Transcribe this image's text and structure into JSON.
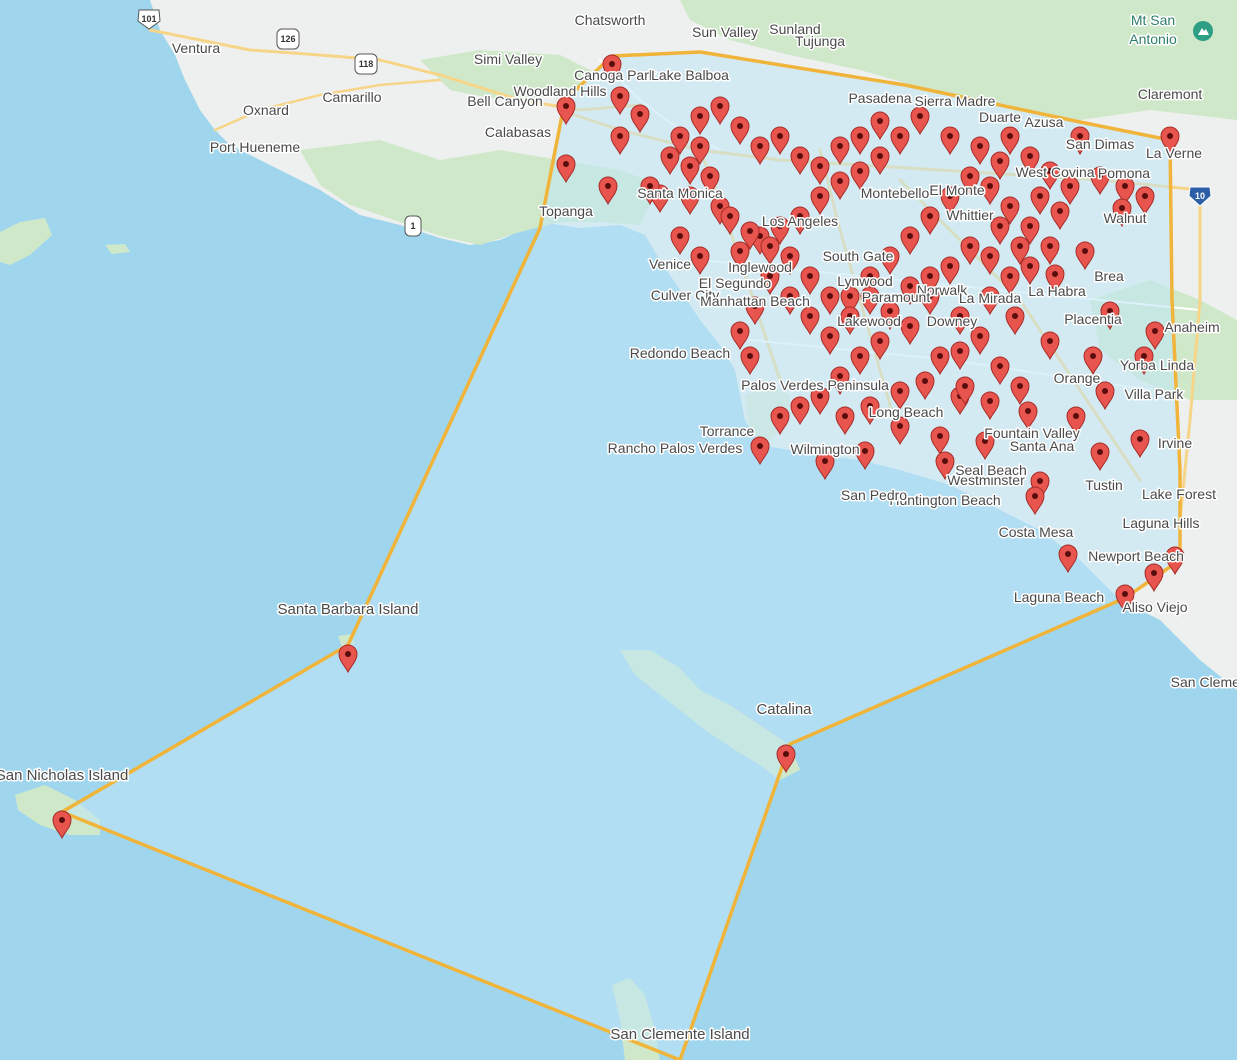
{
  "map": {
    "colors": {
      "water": "#9fd6ee",
      "land": "#eef0ef",
      "park": "#cfe8c9",
      "polygon_fill": "#b9e3f2",
      "polygon_stroke": "#f0b43a",
      "pin": "#e8554e",
      "pin_dot": "#5a0d0d",
      "road": "#ffffff",
      "highway": "#f7d588"
    },
    "highway_shields": [
      {
        "label": "101",
        "icon": "us-highway-shield"
      },
      {
        "label": "126",
        "icon": "state-highway-shield"
      },
      {
        "label": "118",
        "icon": "state-highway-shield"
      },
      {
        "label": "1",
        "icon": "state-highway-shield"
      },
      {
        "label": "10",
        "icon": "interstate-shield"
      }
    ],
    "poi": {
      "label": "Mt San Antonio",
      "line1": "Mt San",
      "line2": "Antonio",
      "icon": "mountain-icon"
    },
    "places": [
      "Chatsworth",
      "Sunland",
      "Tujunga",
      "Sun Valley",
      "Canoga Park",
      "Lake Balboa",
      "Ventura",
      "Simi Valley",
      "Oxnard",
      "Camarillo",
      "Port Hueneme",
      "Woodland Hills",
      "Bell Canyon",
      "Calabasas",
      "Topanga",
      "Claremont",
      "La Verne",
      "Azusa",
      "Duarte",
      "Sierra Madre",
      "Pasadena",
      "San Dimas",
      "West Covina",
      "Pomona",
      "Walnut",
      "Brea",
      "La Habra",
      "Placentia",
      "Anaheim",
      "Yorba Linda",
      "Orange",
      "Villa Park",
      "Irvine",
      "Tustin",
      "Santa Ana",
      "Fountain Valley",
      "Westminster",
      "Seal Beach",
      "Huntington Beach",
      "Costa Mesa",
      "Newport Beach",
      "Laguna Hills",
      "Laguna Beach",
      "Aliso Viejo",
      "Lake Forest",
      "San Clemente",
      "Long Beach",
      "Lakewood",
      "Torrance",
      "Redondo Beach",
      "Rancho Palos Verdes",
      "Palos Verdes Peninsula",
      "Wilmington",
      "San Pedro",
      "Venice",
      "Culver City",
      "Santa Monica",
      "Manhattan Beach",
      "El Segundo",
      "Inglewood",
      "Los Angeles",
      "Whittier",
      "Norwalk",
      "La Mirada",
      "Downey",
      "Paramount",
      "Lynwood",
      "South Gate",
      "Montebello",
      "El Monte",
      "Santa Barbara Island",
      "San Nicholas Island",
      "Catalina",
      "San Clemente Island"
    ]
  }
}
